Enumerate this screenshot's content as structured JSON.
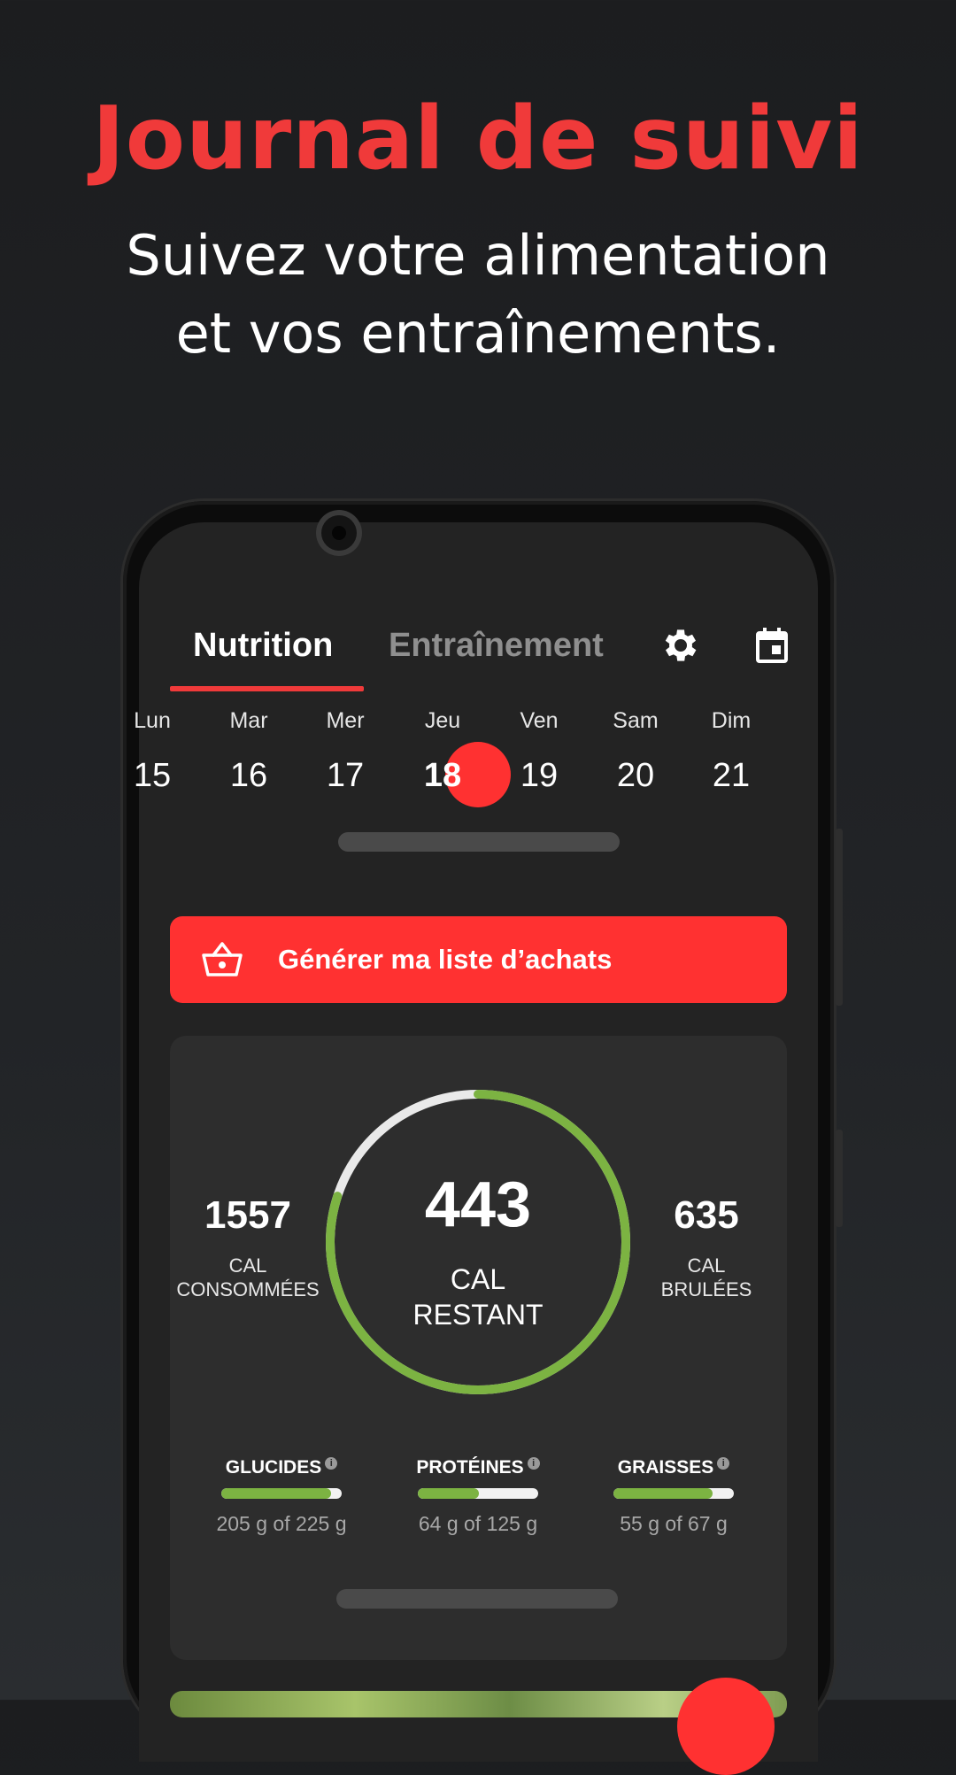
{
  "headline": "Journal de suivi",
  "subline": [
    "Suivez votre alimentation",
    "et vos entraînements."
  ],
  "colors": {
    "accent": "#ff3131",
    "headline": "#f03a3a",
    "progress": "#7cb342",
    "card": "#2d2d2d",
    "screen": "#232323"
  },
  "tabs": [
    {
      "label": "Nutrition",
      "active": true
    },
    {
      "label": "Entraînement",
      "active": false
    }
  ],
  "toolbar_icons": [
    "gear-icon",
    "calendar-icon"
  ],
  "week": [
    {
      "name": "Lun",
      "num": "15"
    },
    {
      "name": "Mar",
      "num": "16"
    },
    {
      "name": "Mer",
      "num": "17"
    },
    {
      "name": "Jeu",
      "num": "18",
      "selected": true
    },
    {
      "name": "Ven",
      "num": "19"
    },
    {
      "name": "Sam",
      "num": "20"
    },
    {
      "name": "Dim",
      "num": "21"
    }
  ],
  "shopping": {
    "label": "Générer ma liste d’achats",
    "icon": "basket-icon"
  },
  "summary": {
    "consumed": {
      "value": "1557",
      "label_1": "CAL",
      "label_2": "CONSOMMÉES"
    },
    "remaining": {
      "value": "443",
      "label_1": "CAL",
      "label_2": "RESTANT"
    },
    "burned": {
      "value": "635",
      "label_1": "CAL",
      "label_2": "BRULÉES"
    },
    "ring_progress": 0.8
  },
  "macros": [
    {
      "name": "GLUCIDES",
      "value": "205 g of 225 g",
      "progress": 0.91
    },
    {
      "name": "PROTÉINES",
      "value": "64 g of 125 g",
      "progress": 0.51
    },
    {
      "name": "GRAISSES",
      "value": "55 g of 67 g",
      "progress": 0.82
    }
  ]
}
